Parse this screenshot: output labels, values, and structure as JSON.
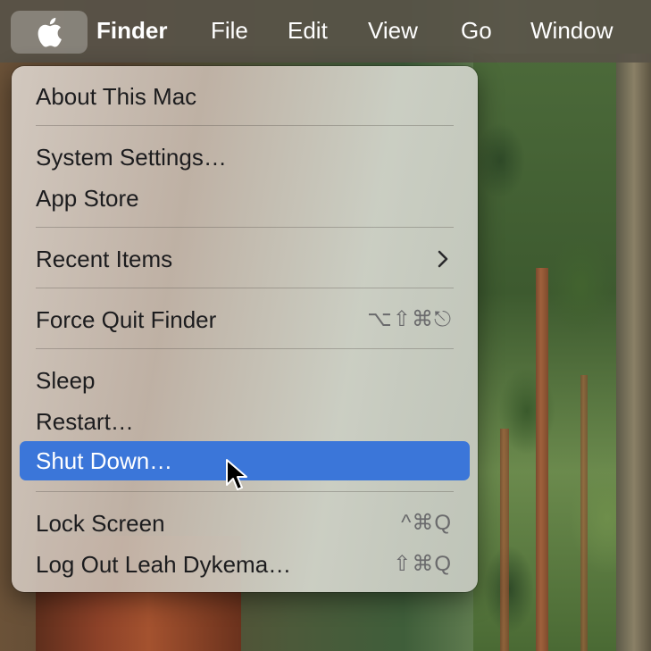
{
  "menubar": {
    "apple_icon": "apple-logo-icon",
    "app_name": "Finder",
    "items": [
      "File",
      "Edit",
      "View",
      "Go",
      "Window"
    ]
  },
  "apple_menu": {
    "items": {
      "about": {
        "label": "About This Mac"
      },
      "settings": {
        "label": "System Settings…"
      },
      "app_store": {
        "label": "App Store"
      },
      "recent": {
        "label": "Recent Items",
        "submenu_icon": "chevron-right-icon"
      },
      "force_quit": {
        "label": "Force Quit Finder",
        "shortcut": "⌥⇧⌘⎋"
      },
      "sleep": {
        "label": "Sleep"
      },
      "restart": {
        "label": "Restart…"
      },
      "shut_down": {
        "label": "Shut Down…",
        "selected": true
      },
      "lock": {
        "label": "Lock Screen",
        "shortcut": "^⌘Q"
      },
      "logout": {
        "label": "Log Out Leah Dykema…",
        "shortcut": "⇧⌘Q"
      }
    }
  },
  "colors": {
    "menubar_bg": "#585248",
    "highlight": "#3b76d9",
    "menu_text": "#1c1c1e",
    "shortcut_text": "#6a6a6c"
  },
  "cursor_icon": "arrow-pointer-icon"
}
